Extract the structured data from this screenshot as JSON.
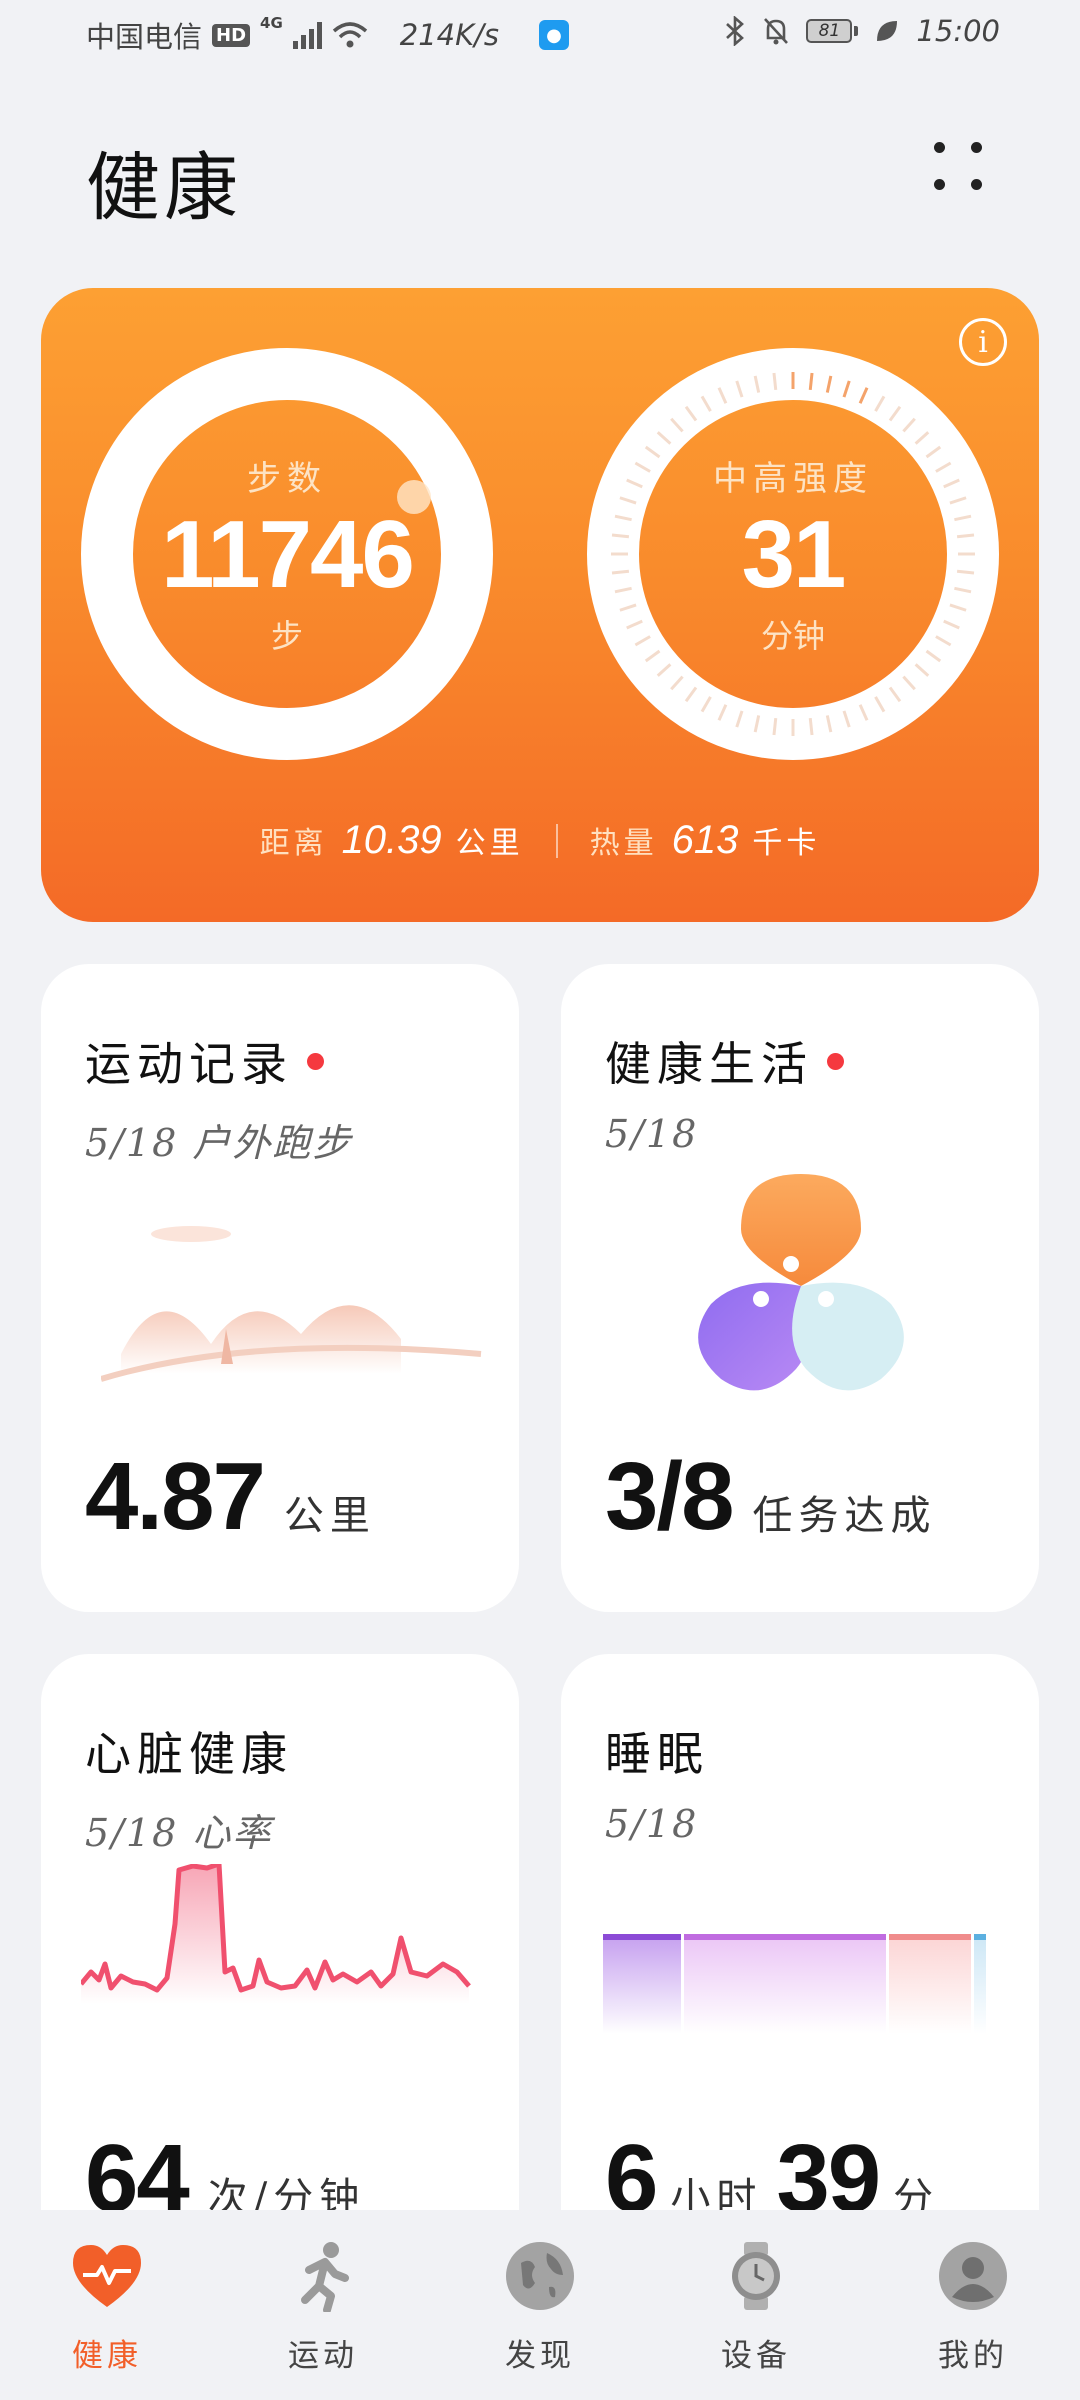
{
  "status_bar": {
    "carrier": "中国电信",
    "hd": "HD",
    "network": "4G",
    "speed": "214K/s",
    "battery": "81",
    "time": "15:00"
  },
  "header": {
    "title": "健康"
  },
  "activity": {
    "steps": {
      "label": "步数",
      "value": "11746",
      "unit": "步"
    },
    "intensity": {
      "label": "中高强度",
      "value": "31",
      "unit": "分钟"
    },
    "distance": {
      "label": "距离",
      "value": "10.39",
      "unit": "公里"
    },
    "calories": {
      "label": "热量",
      "value": "613",
      "unit": "千卡"
    }
  },
  "cards": {
    "exercise": {
      "title": "运动记录",
      "subtitle": "5/18 户外跑步",
      "value": "4.87",
      "unit": "公里"
    },
    "healthy_living": {
      "title": "健康生活",
      "subtitle": "5/18",
      "value": "3/8",
      "unit": "任务达成"
    },
    "heart": {
      "title": "心脏健康",
      "subtitle": "5/18 心率",
      "value": "64",
      "unit": "次/分钟"
    },
    "sleep": {
      "title": "睡眠",
      "subtitle": "5/18",
      "hours": "6",
      "hours_unit": "小时",
      "minutes": "39",
      "minutes_unit": "分"
    }
  },
  "tabs": [
    {
      "label": "健康",
      "icon": "heart-icon",
      "active": true
    },
    {
      "label": "运动",
      "icon": "runner-icon",
      "active": false
    },
    {
      "label": "发现",
      "icon": "globe-icon",
      "active": false
    },
    {
      "label": "设备",
      "icon": "watch-icon",
      "active": false
    },
    {
      "label": "我的",
      "icon": "profile-icon",
      "active": false
    }
  ],
  "colors": {
    "accent": "#f25f29",
    "card_orange": "#f98b2c",
    "heart_line": "#f0506e",
    "badge": "#f5393f"
  }
}
